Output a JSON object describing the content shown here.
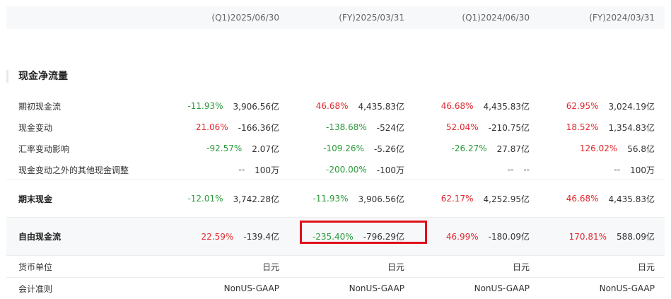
{
  "columns": [
    "(Q1)2025/06/30",
    "(FY)2025/03/31",
    "(Q1)2024/06/30",
    "(FY)2024/03/31"
  ],
  "section_title": "现金净流量",
  "rows": [
    {
      "label": "期初现金流",
      "cells": [
        {
          "pct": "-11.93%",
          "trend": "neg",
          "value": "3,906.56亿"
        },
        {
          "pct": "46.68%",
          "trend": "pos",
          "value": "4,435.83亿"
        },
        {
          "pct": "46.68%",
          "trend": "pos",
          "value": "4,435.83亿"
        },
        {
          "pct": "62.95%",
          "trend": "pos",
          "value": "3,024.19亿"
        }
      ]
    },
    {
      "label": "现金变动",
      "cells": [
        {
          "pct": "21.06%",
          "trend": "pos",
          "value": "-166.36亿"
        },
        {
          "pct": "-138.68%",
          "trend": "neg",
          "value": "-524亿"
        },
        {
          "pct": "52.04%",
          "trend": "pos",
          "value": "-210.75亿"
        },
        {
          "pct": "18.52%",
          "trend": "pos",
          "value": "1,354.83亿"
        }
      ]
    },
    {
      "label": "汇率变动影响",
      "cells": [
        {
          "pct": "-92.57%",
          "trend": "neg",
          "value": "2.07亿"
        },
        {
          "pct": "-109.26%",
          "trend": "neg",
          "value": "-5.26亿"
        },
        {
          "pct": "-26.27%",
          "trend": "neg",
          "value": "27.87亿"
        },
        {
          "pct": "126.02%",
          "trend": "pos",
          "value": "56.8亿"
        }
      ]
    },
    {
      "label": "现金变动之外的其他现金调整",
      "cells": [
        {
          "pct": "--",
          "trend": "plain",
          "value": "100万"
        },
        {
          "pct": "-200.00%",
          "trend": "neg",
          "value": "-100万"
        },
        {
          "pct": "--",
          "trend": "plain",
          "value": "--"
        },
        {
          "pct": "--",
          "trend": "plain",
          "value": "100万"
        }
      ]
    },
    {
      "label": "期末现金",
      "cells": [
        {
          "pct": "-12.01%",
          "trend": "neg",
          "value": "3,742.28亿"
        },
        {
          "pct": "-11.93%",
          "trend": "neg",
          "value": "3,906.56亿"
        },
        {
          "pct": "62.17%",
          "trend": "pos",
          "value": "4,252.95亿"
        },
        {
          "pct": "46.68%",
          "trend": "pos",
          "value": "4,435.83亿"
        }
      ]
    },
    {
      "label": "自由现金流",
      "cells": [
        {
          "pct": "22.59%",
          "trend": "pos",
          "value": "-139.4亿"
        },
        {
          "pct": "-235.40%",
          "trend": "neg",
          "value": "-796.29亿"
        },
        {
          "pct": "46.99%",
          "trend": "pos",
          "value": "-180.09亿"
        },
        {
          "pct": "170.81%",
          "trend": "pos",
          "value": "588.09亿"
        }
      ]
    },
    {
      "label": "货币单位",
      "cells": [
        {
          "pct": "",
          "trend": "plain",
          "value": "日元"
        },
        {
          "pct": "",
          "trend": "plain",
          "value": "日元"
        },
        {
          "pct": "",
          "trend": "plain",
          "value": "日元"
        },
        {
          "pct": "",
          "trend": "plain",
          "value": "日元"
        }
      ]
    },
    {
      "label": "会计准则",
      "cells": [
        {
          "pct": "",
          "trend": "plain",
          "value": "NonUS-GAAP"
        },
        {
          "pct": "",
          "trend": "plain",
          "value": "NonUS-GAAP"
        },
        {
          "pct": "",
          "trend": "plain",
          "value": "NonUS-GAAP"
        },
        {
          "pct": "",
          "trend": "plain",
          "value": "NonUS-GAAP"
        }
      ]
    }
  ],
  "colors": {
    "positive": "#e0282e",
    "negative": "#2a9a3a",
    "highlight_border": "#e0101a"
  }
}
